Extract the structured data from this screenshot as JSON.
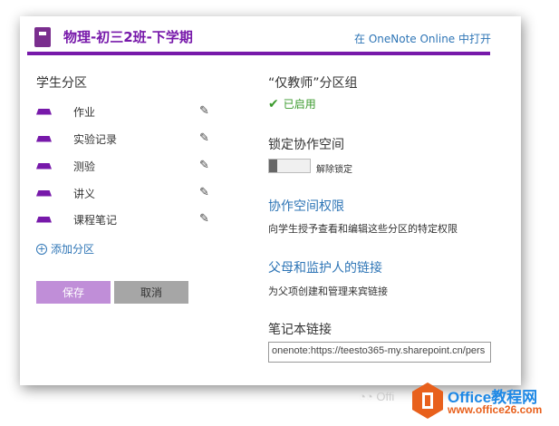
{
  "header": {
    "title": "物理-初三2班-下学期",
    "open_link": "在 OneNote Online 中打开",
    "icon": "notebook-icon"
  },
  "left": {
    "heading": "学生分区",
    "sections": [
      {
        "label": "作业"
      },
      {
        "label": "实验记录"
      },
      {
        "label": "测验"
      },
      {
        "label": "讲义"
      },
      {
        "label": "课程笔记"
      }
    ],
    "add_section": "添加分区",
    "save": "保存",
    "cancel": "取消"
  },
  "right": {
    "teacher_only": {
      "heading": "“仅教师”分区组",
      "status": "已启用"
    },
    "lock": {
      "heading": "锁定协作空间",
      "toggle_label": "解除锁定",
      "locked": false
    },
    "permissions": {
      "link": "协作空间权限",
      "desc": "向学生授予查看和编辑这些分区的特定权限"
    },
    "parents": {
      "link": "父母和监护人的链接",
      "desc": "为父项创建和管理来宾链接"
    },
    "notebook_link": {
      "heading": "笔记本链接",
      "value": "onenote:https://teesto365-my.sharepoint.cn/pers"
    }
  },
  "watermark": {
    "text1": "Office教程网",
    "text2": "www.office26.com",
    "text3": "Offi",
    "accent": "#e8601c"
  }
}
